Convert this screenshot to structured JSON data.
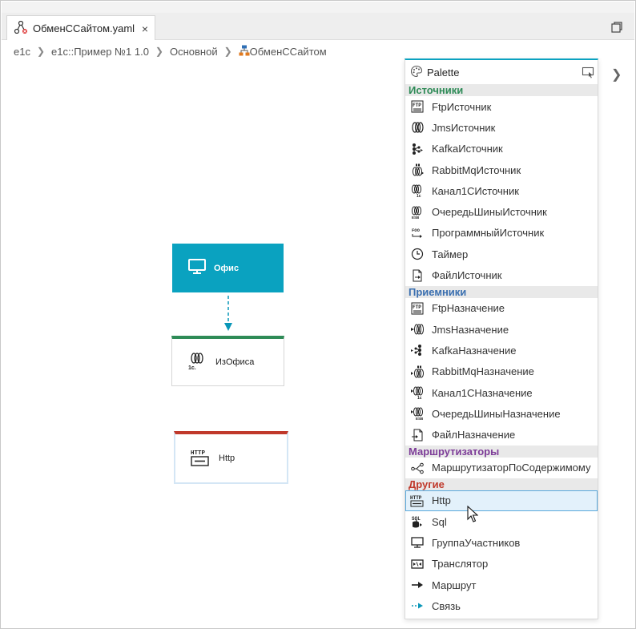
{
  "tab": {
    "title": "ОбменССайтом.yaml",
    "close_glyph": "×"
  },
  "breadcrumb": [
    "e1c",
    "e1c::Пример №1 1.0",
    "Основной",
    "ОбменССайтом"
  ],
  "canvas": {
    "nodes": [
      {
        "label": "Офис"
      },
      {
        "label": "ИзОфиса"
      },
      {
        "label": "Http"
      }
    ]
  },
  "palette": {
    "title": "Palette",
    "sections": [
      {
        "title": "Источники",
        "color": "#2e8b57",
        "items": [
          "FtpИсточник",
          "JmsИсточник",
          "KafkaИсточник",
          "RabbitMqИсточник",
          "Канал1СИсточник",
          "ОчередьШиныИсточник",
          "ПрограммныйИсточник",
          "Таймер",
          "ФайлИсточник"
        ]
      },
      {
        "title": "Приемники",
        "color": "#3a6fb0",
        "items": [
          "FtpНазначение",
          "JmsНазначение",
          "KafkaНазначение",
          "RabbitMqНазначение",
          "Канал1СНазначение",
          "ОчередьШиныНазначение",
          "ФайлНазначение"
        ]
      },
      {
        "title": "Маршрутизаторы",
        "color": "#7d3c98",
        "items": [
          "МаршрутизаторПоСодержимому"
        ]
      },
      {
        "title": "Другие",
        "color": "#c0392b",
        "items": [
          "Http",
          "Sql",
          "ГруппаУчастников",
          "Транслятор",
          "Маршрут",
          "Связь"
        ],
        "selected": "Http"
      }
    ]
  },
  "icons": {
    "tab": "diagram-file-icon",
    "office": "monitor-icon",
    "izofisa": "channel-1c-icon",
    "http": "http-icon",
    "palette": "palette-icon"
  },
  "colors": {
    "accent": "#0aa2c0",
    "sources": "#2e8b57",
    "receivers": "#3a6fb0",
    "routers": "#7d3c98",
    "other": "#c0392b"
  }
}
